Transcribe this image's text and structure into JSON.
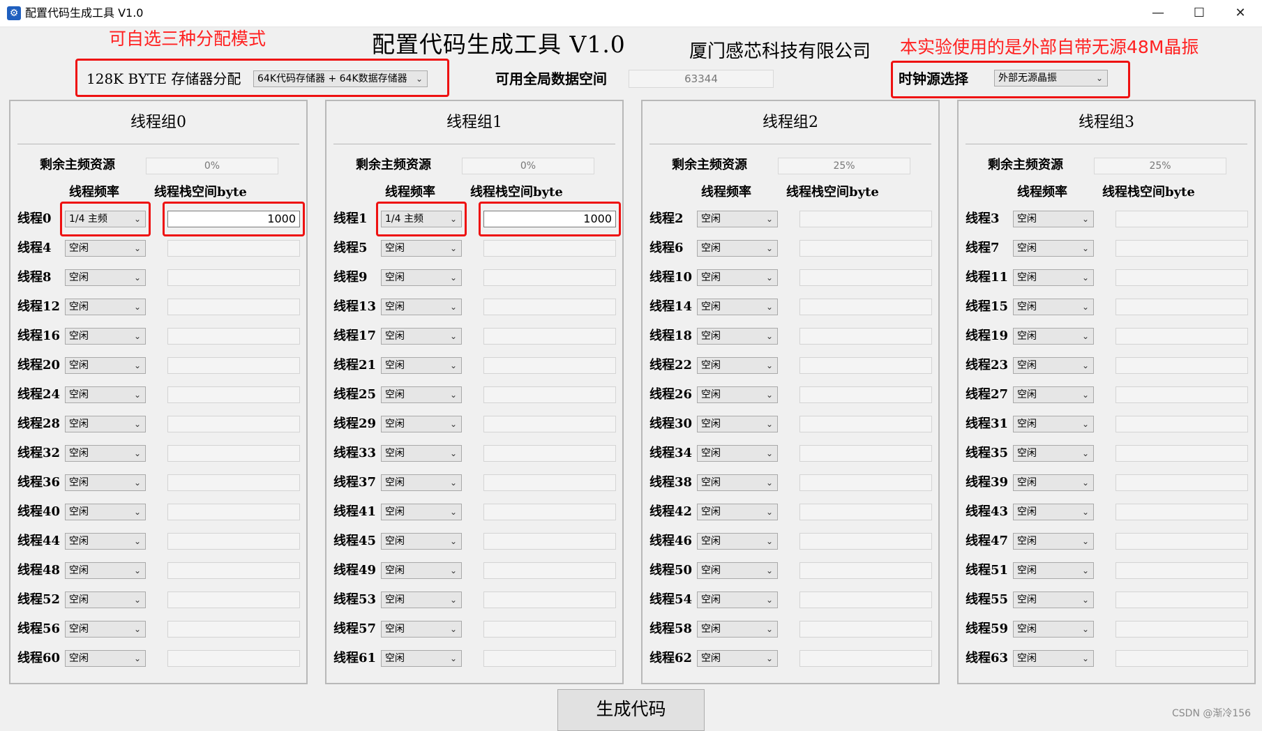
{
  "window": {
    "title": "配置代码生成工具 V1.0",
    "minimize": "—",
    "maximize": "☐",
    "close": "✕"
  },
  "header": {
    "title": "配置代码生成工具 V1.0",
    "company": "厦门感芯科技有限公司",
    "memory_label": "128K BYTE 存储器分配",
    "memory_value": "64K代码存储器 + 64K数据存储器",
    "global_space_label": "可用全局数据空间",
    "global_space_value": "63344",
    "clock_label": "时钟源选择",
    "clock_value": "外部无源晶振"
  },
  "annotations": {
    "left": "可自选三种分配模式",
    "right": "本实验使用的是外部自带无源48M晶振"
  },
  "common": {
    "remaining_label": "剩余主频资源",
    "freq_header": "线程频率",
    "stack_header": "线程栈空间byte",
    "idle": "空闲",
    "arrow": "⌄"
  },
  "groups": [
    {
      "title": "线程组0",
      "remaining": "0%",
      "threads": [
        {
          "label": "线程0",
          "freq": "1/4 主频",
          "stack": "1000"
        },
        {
          "label": "线程4",
          "freq": "空闲",
          "stack": ""
        },
        {
          "label": "线程8",
          "freq": "空闲",
          "stack": ""
        },
        {
          "label": "线程12",
          "freq": "空闲",
          "stack": ""
        },
        {
          "label": "线程16",
          "freq": "空闲",
          "stack": ""
        },
        {
          "label": "线程20",
          "freq": "空闲",
          "stack": ""
        },
        {
          "label": "线程24",
          "freq": "空闲",
          "stack": ""
        },
        {
          "label": "线程28",
          "freq": "空闲",
          "stack": ""
        },
        {
          "label": "线程32",
          "freq": "空闲",
          "stack": ""
        },
        {
          "label": "线程36",
          "freq": "空闲",
          "stack": ""
        },
        {
          "label": "线程40",
          "freq": "空闲",
          "stack": ""
        },
        {
          "label": "线程44",
          "freq": "空闲",
          "stack": ""
        },
        {
          "label": "线程48",
          "freq": "空闲",
          "stack": ""
        },
        {
          "label": "线程52",
          "freq": "空闲",
          "stack": ""
        },
        {
          "label": "线程56",
          "freq": "空闲",
          "stack": ""
        },
        {
          "label": "线程60",
          "freq": "空闲",
          "stack": ""
        }
      ]
    },
    {
      "title": "线程组1",
      "remaining": "0%",
      "threads": [
        {
          "label": "线程1",
          "freq": "1/4 主频",
          "stack": "1000"
        },
        {
          "label": "线程5",
          "freq": "空闲",
          "stack": ""
        },
        {
          "label": "线程9",
          "freq": "空闲",
          "stack": ""
        },
        {
          "label": "线程13",
          "freq": "空闲",
          "stack": ""
        },
        {
          "label": "线程17",
          "freq": "空闲",
          "stack": ""
        },
        {
          "label": "线程21",
          "freq": "空闲",
          "stack": ""
        },
        {
          "label": "线程25",
          "freq": "空闲",
          "stack": ""
        },
        {
          "label": "线程29",
          "freq": "空闲",
          "stack": ""
        },
        {
          "label": "线程33",
          "freq": "空闲",
          "stack": ""
        },
        {
          "label": "线程37",
          "freq": "空闲",
          "stack": ""
        },
        {
          "label": "线程41",
          "freq": "空闲",
          "stack": ""
        },
        {
          "label": "线程45",
          "freq": "空闲",
          "stack": ""
        },
        {
          "label": "线程49",
          "freq": "空闲",
          "stack": ""
        },
        {
          "label": "线程53",
          "freq": "空闲",
          "stack": ""
        },
        {
          "label": "线程57",
          "freq": "空闲",
          "stack": ""
        },
        {
          "label": "线程61",
          "freq": "空闲",
          "stack": ""
        }
      ]
    },
    {
      "title": "线程组2",
      "remaining": "25%",
      "threads": [
        {
          "label": "线程2",
          "freq": "空闲",
          "stack": ""
        },
        {
          "label": "线程6",
          "freq": "空闲",
          "stack": ""
        },
        {
          "label": "线程10",
          "freq": "空闲",
          "stack": ""
        },
        {
          "label": "线程14",
          "freq": "空闲",
          "stack": ""
        },
        {
          "label": "线程18",
          "freq": "空闲",
          "stack": ""
        },
        {
          "label": "线程22",
          "freq": "空闲",
          "stack": ""
        },
        {
          "label": "线程26",
          "freq": "空闲",
          "stack": ""
        },
        {
          "label": "线程30",
          "freq": "空闲",
          "stack": ""
        },
        {
          "label": "线程34",
          "freq": "空闲",
          "stack": ""
        },
        {
          "label": "线程38",
          "freq": "空闲",
          "stack": ""
        },
        {
          "label": "线程42",
          "freq": "空闲",
          "stack": ""
        },
        {
          "label": "线程46",
          "freq": "空闲",
          "stack": ""
        },
        {
          "label": "线程50",
          "freq": "空闲",
          "stack": ""
        },
        {
          "label": "线程54",
          "freq": "空闲",
          "stack": ""
        },
        {
          "label": "线程58",
          "freq": "空闲",
          "stack": ""
        },
        {
          "label": "线程62",
          "freq": "空闲",
          "stack": ""
        }
      ]
    },
    {
      "title": "线程组3",
      "remaining": "25%",
      "threads": [
        {
          "label": "线程3",
          "freq": "空闲",
          "stack": ""
        },
        {
          "label": "线程7",
          "freq": "空闲",
          "stack": ""
        },
        {
          "label": "线程11",
          "freq": "空闲",
          "stack": ""
        },
        {
          "label": "线程15",
          "freq": "空闲",
          "stack": ""
        },
        {
          "label": "线程19",
          "freq": "空闲",
          "stack": ""
        },
        {
          "label": "线程23",
          "freq": "空闲",
          "stack": ""
        },
        {
          "label": "线程27",
          "freq": "空闲",
          "stack": ""
        },
        {
          "label": "线程31",
          "freq": "空闲",
          "stack": ""
        },
        {
          "label": "线程35",
          "freq": "空闲",
          "stack": ""
        },
        {
          "label": "线程39",
          "freq": "空闲",
          "stack": ""
        },
        {
          "label": "线程43",
          "freq": "空闲",
          "stack": ""
        },
        {
          "label": "线程47",
          "freq": "空闲",
          "stack": ""
        },
        {
          "label": "线程51",
          "freq": "空闲",
          "stack": ""
        },
        {
          "label": "线程55",
          "freq": "空闲",
          "stack": ""
        },
        {
          "label": "线程59",
          "freq": "空闲",
          "stack": ""
        },
        {
          "label": "线程63",
          "freq": "空闲",
          "stack": ""
        }
      ]
    }
  ],
  "generate_button": "生成代码",
  "watermark": "CSDN @渐冷156"
}
